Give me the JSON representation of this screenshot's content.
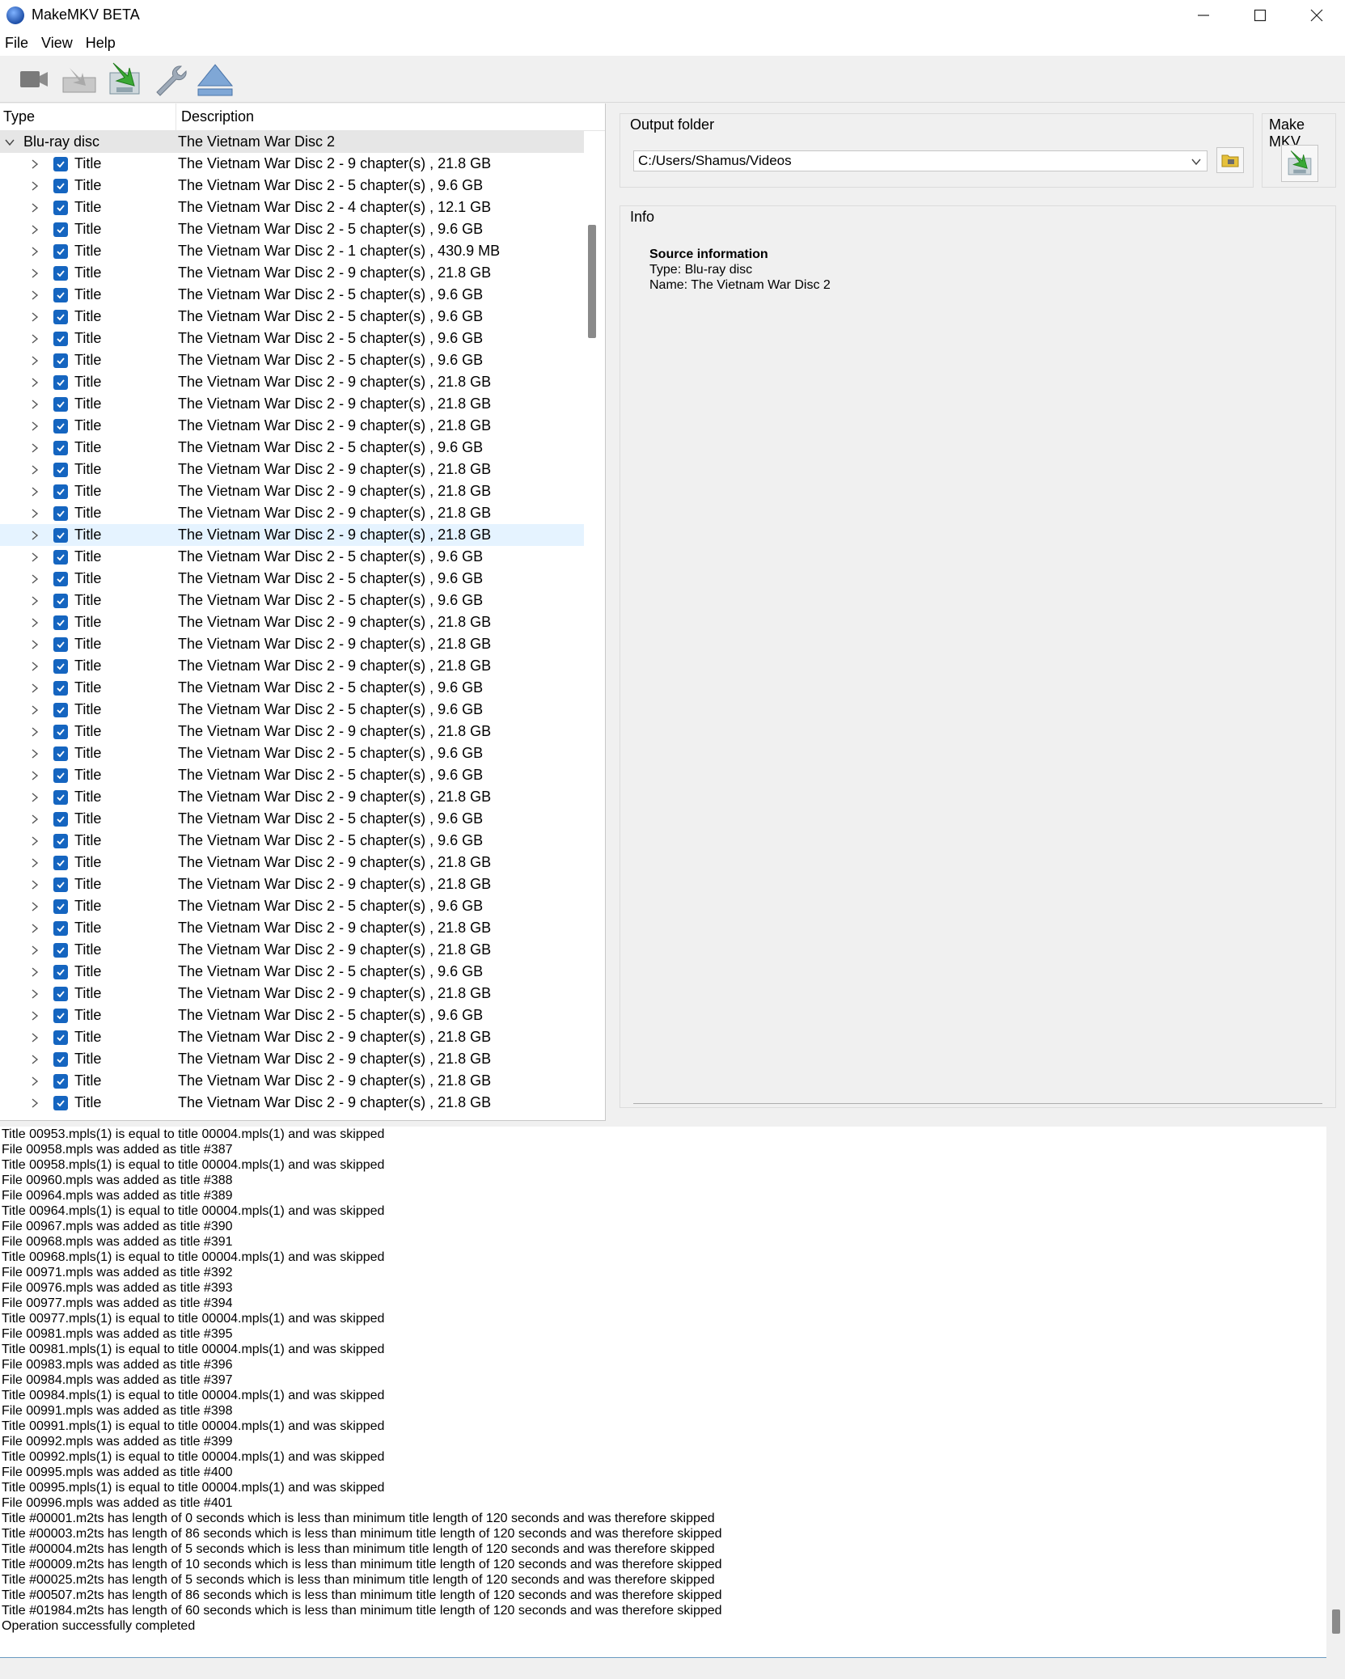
{
  "window": {
    "title": "MakeMKV BETA"
  },
  "menu": [
    "File",
    "View",
    "Help"
  ],
  "toolbar": {
    "icons": [
      "open-video-icon",
      "open-files-icon",
      "backup-icon",
      "settings-wrench-icon",
      "eject-icon"
    ]
  },
  "tree": {
    "headers": {
      "type": "Type",
      "description": "Description"
    },
    "root": {
      "type": "Blu-ray disc",
      "description": "The Vietnam War Disc 2"
    },
    "title_label": "Title",
    "selected_index": 17,
    "rows": [
      "The Vietnam War Disc 2 - 9 chapter(s) , 21.8 GB",
      "The Vietnam War Disc 2 - 5 chapter(s) , 9.6 GB",
      "The Vietnam War Disc 2 - 4 chapter(s) , 12.1 GB",
      "The Vietnam War Disc 2 - 5 chapter(s) , 9.6 GB",
      "The Vietnam War Disc 2 - 1 chapter(s) , 430.9 MB",
      "The Vietnam War Disc 2 - 9 chapter(s) , 21.8 GB",
      "The Vietnam War Disc 2 - 5 chapter(s) , 9.6 GB",
      "The Vietnam War Disc 2 - 5 chapter(s) , 9.6 GB",
      "The Vietnam War Disc 2 - 5 chapter(s) , 9.6 GB",
      "The Vietnam War Disc 2 - 5 chapter(s) , 9.6 GB",
      "The Vietnam War Disc 2 - 9 chapter(s) , 21.8 GB",
      "The Vietnam War Disc 2 - 9 chapter(s) , 21.8 GB",
      "The Vietnam War Disc 2 - 9 chapter(s) , 21.8 GB",
      "The Vietnam War Disc 2 - 5 chapter(s) , 9.6 GB",
      "The Vietnam War Disc 2 - 9 chapter(s) , 21.8 GB",
      "The Vietnam War Disc 2 - 9 chapter(s) , 21.8 GB",
      "The Vietnam War Disc 2 - 9 chapter(s) , 21.8 GB",
      "The Vietnam War Disc 2 - 9 chapter(s) , 21.8 GB",
      "The Vietnam War Disc 2 - 5 chapter(s) , 9.6 GB",
      "The Vietnam War Disc 2 - 5 chapter(s) , 9.6 GB",
      "The Vietnam War Disc 2 - 5 chapter(s) , 9.6 GB",
      "The Vietnam War Disc 2 - 9 chapter(s) , 21.8 GB",
      "The Vietnam War Disc 2 - 9 chapter(s) , 21.8 GB",
      "The Vietnam War Disc 2 - 9 chapter(s) , 21.8 GB",
      "The Vietnam War Disc 2 - 5 chapter(s) , 9.6 GB",
      "The Vietnam War Disc 2 - 5 chapter(s) , 9.6 GB",
      "The Vietnam War Disc 2 - 9 chapter(s) , 21.8 GB",
      "The Vietnam War Disc 2 - 5 chapter(s) , 9.6 GB",
      "The Vietnam War Disc 2 - 5 chapter(s) , 9.6 GB",
      "The Vietnam War Disc 2 - 9 chapter(s) , 21.8 GB",
      "The Vietnam War Disc 2 - 5 chapter(s) , 9.6 GB",
      "The Vietnam War Disc 2 - 5 chapter(s) , 9.6 GB",
      "The Vietnam War Disc 2 - 9 chapter(s) , 21.8 GB",
      "The Vietnam War Disc 2 - 9 chapter(s) , 21.8 GB",
      "The Vietnam War Disc 2 - 5 chapter(s) , 9.6 GB",
      "The Vietnam War Disc 2 - 9 chapter(s) , 21.8 GB",
      "The Vietnam War Disc 2 - 9 chapter(s) , 21.8 GB",
      "The Vietnam War Disc 2 - 5 chapter(s) , 9.6 GB",
      "The Vietnam War Disc 2 - 9 chapter(s) , 21.8 GB",
      "The Vietnam War Disc 2 - 5 chapter(s) , 9.6 GB",
      "The Vietnam War Disc 2 - 9 chapter(s) , 21.8 GB",
      "The Vietnam War Disc 2 - 9 chapter(s) , 21.8 GB",
      "The Vietnam War Disc 2 - 9 chapter(s) , 21.8 GB",
      "The Vietnam War Disc 2 - 9 chapter(s) , 21.8 GB"
    ]
  },
  "output": {
    "label": "Output folder",
    "path": "C:/Users/Shamus/Videos"
  },
  "makemkv": {
    "label": "Make MKV"
  },
  "info": {
    "label": "Info",
    "heading": "Source information",
    "type_line": "Type: Blu-ray disc",
    "name_line": "Name: The Vietnam War Disc 2"
  },
  "log": [
    "Title 00953.mpls(1) is equal to title 00004.mpls(1) and was skipped",
    "File 00958.mpls was added as title #387",
    "Title 00958.mpls(1) is equal to title 00004.mpls(1) and was skipped",
    "File 00960.mpls was added as title #388",
    "File 00964.mpls was added as title #389",
    "Title 00964.mpls(1) is equal to title 00004.mpls(1) and was skipped",
    "File 00967.mpls was added as title #390",
    "File 00968.mpls was added as title #391",
    "Title 00968.mpls(1) is equal to title 00004.mpls(1) and was skipped",
    "File 00971.mpls was added as title #392",
    "File 00976.mpls was added as title #393",
    "File 00977.mpls was added as title #394",
    "Title 00977.mpls(1) is equal to title 00004.mpls(1) and was skipped",
    "File 00981.mpls was added as title #395",
    "Title 00981.mpls(1) is equal to title 00004.mpls(1) and was skipped",
    "File 00983.mpls was added as title #396",
    "File 00984.mpls was added as title #397",
    "Title 00984.mpls(1) is equal to title 00004.mpls(1) and was skipped",
    "File 00991.mpls was added as title #398",
    "Title 00991.mpls(1) is equal to title 00004.mpls(1) and was skipped",
    "File 00992.mpls was added as title #399",
    "Title 00992.mpls(1) is equal to title 00004.mpls(1) and was skipped",
    "File 00995.mpls was added as title #400",
    "Title 00995.mpls(1) is equal to title 00004.mpls(1) and was skipped",
    "File 00996.mpls was added as title #401",
    "Title #00001.m2ts has length of 0 seconds which is less than minimum title length of 120 seconds and was therefore skipped",
    "Title #00003.m2ts has length of 86 seconds which is less than minimum title length of 120 seconds and was therefore skipped",
    "Title #00004.m2ts has length of 5 seconds which is less than minimum title length of 120 seconds and was therefore skipped",
    "Title #00009.m2ts has length of 10 seconds which is less than minimum title length of 120 seconds and was therefore skipped",
    "Title #00025.m2ts has length of 5 seconds which is less than minimum title length of 120 seconds and was therefore skipped",
    "Title #00507.m2ts has length of 86 seconds which is less than minimum title length of 120 seconds and was therefore skipped",
    "Title #01984.m2ts has length of 60 seconds which is less than minimum title length of 120 seconds and was therefore skipped",
    "Operation successfully completed"
  ]
}
